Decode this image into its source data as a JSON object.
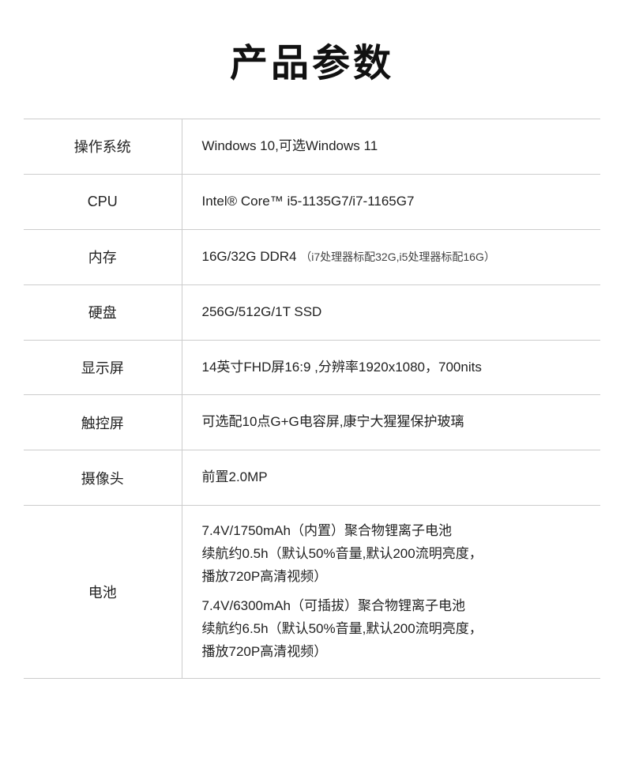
{
  "title": "产品参数",
  "table": {
    "rows": [
      {
        "label": "操作系统",
        "value": "Windows 10,可选Windows 11",
        "multiline": false
      },
      {
        "label": "CPU",
        "value": "Intel® Core™  i5-1135G7/i7-1165G7",
        "multiline": false
      },
      {
        "label": "内存",
        "value": "16G/32G DDR4",
        "note": "（i7处理器标配32G,i5处理器标配16G）",
        "multiline": false
      },
      {
        "label": "硬盘",
        "value": " 256G/512G/1T SSD",
        "multiline": false
      },
      {
        "label": "显示屏",
        "value": "14英寸FHD屏16:9 ,分辨率1920x1080，700nits",
        "multiline": false
      },
      {
        "label": "触控屏",
        "value": "可选配10点G+G电容屏,康宁大猩猩保护玻璃",
        "multiline": false
      },
      {
        "label": "摄像头",
        "value": " 前置2.0MP",
        "multiline": false
      },
      {
        "label": "电池",
        "multiline": true,
        "lines": [
          "7.4V/1750mAh（内置）聚合物锂离子电池",
          "续航约0.5h（默认50%音量,默认200流明亮度，",
          "播放720P高清视频）",
          "7.4V/6300mAh（可插拔）聚合物锂离子电池",
          "续航约6.5h（默认50%音量,默认200流明亮度，",
          "播放720P高清视频）"
        ]
      }
    ]
  }
}
